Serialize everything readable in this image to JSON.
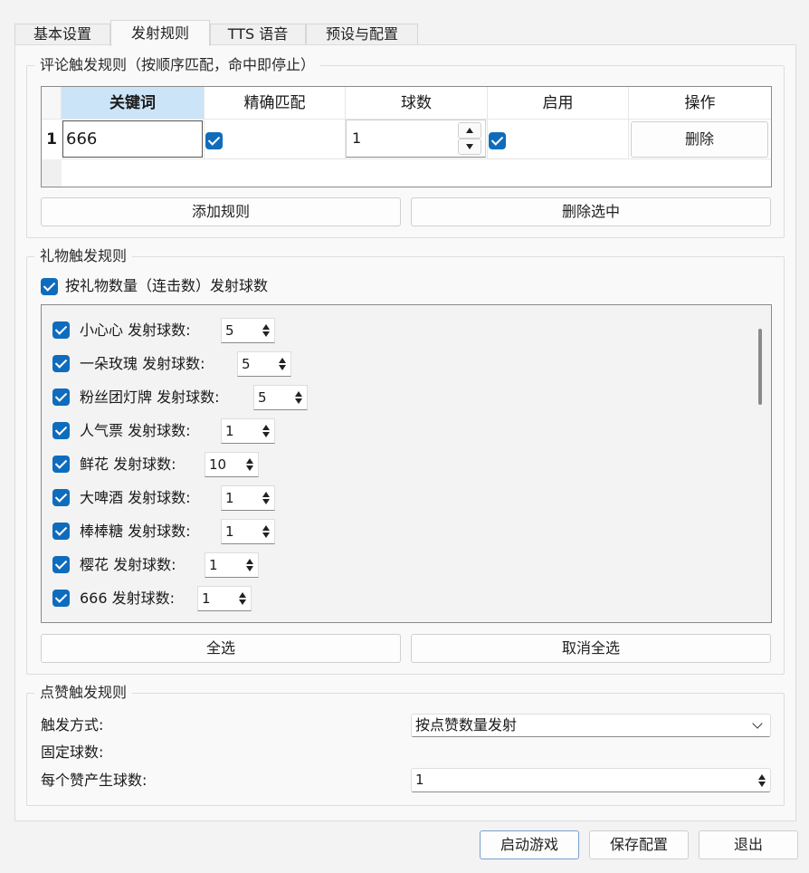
{
  "tabs": [
    {
      "label": "基本设置",
      "active": false
    },
    {
      "label": "发射规则",
      "active": true
    },
    {
      "label": "TTS 语音",
      "active": false
    },
    {
      "label": "预设与配置",
      "active": false
    }
  ],
  "comment_rules": {
    "title": "评论触发规则（按顺序匹配，命中即停止）",
    "columns": [
      "关键词",
      "精确匹配",
      "球数",
      "启用",
      "操作"
    ],
    "rows": [
      {
        "index": "1",
        "keyword": "666",
        "exact": true,
        "balls": "1",
        "enabled": true,
        "action_label": "删除"
      }
    ],
    "add_button": "添加规则",
    "delete_selected_button": "删除选中"
  },
  "gift_rules": {
    "title": "礼物触发规则",
    "by_count_label": "按礼物数量（连击数）发射球数",
    "by_count_checked": true,
    "balls_label": "发射球数:",
    "items": [
      {
        "name": "小心心",
        "balls": "5",
        "checked": true
      },
      {
        "name": "一朵玫瑰",
        "balls": "5",
        "checked": true
      },
      {
        "name": "粉丝团灯牌",
        "balls": "5",
        "checked": true
      },
      {
        "name": "人气票",
        "balls": "1",
        "checked": true
      },
      {
        "name": "鲜花",
        "balls": "10",
        "checked": true
      },
      {
        "name": "大啤酒",
        "balls": "1",
        "checked": true
      },
      {
        "name": "棒棒糖",
        "balls": "1",
        "checked": true
      },
      {
        "name": "樱花",
        "balls": "1",
        "checked": true
      },
      {
        "name": "666",
        "balls": "1",
        "checked": true
      }
    ],
    "select_all_button": "全选",
    "deselect_all_button": "取消全选"
  },
  "like_rules": {
    "title": "点赞触发规则",
    "trigger_mode_label": "触发方式:",
    "trigger_mode_value": "按点赞数量发射",
    "fixed_balls_label": "固定球数:",
    "per_like_label": "每个赞产生球数:",
    "per_like_value": "1"
  },
  "footer": {
    "start_button": "启动游戏",
    "save_button": "保存配置",
    "exit_button": "退出"
  },
  "colors": {
    "accent": "#0f6cbd",
    "header_selected": "#cce4f7"
  }
}
